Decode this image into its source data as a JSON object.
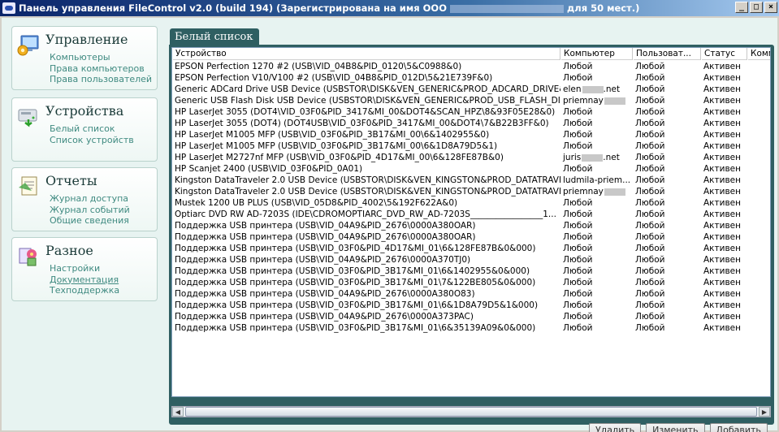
{
  "window": {
    "title_prefix": "Панель управления FileControl v2.0 (build 194) (Зарегистрирована на имя ООО",
    "title_suffix": "для 50 мест.)",
    "buttons": [
      "_",
      "□",
      "×"
    ]
  },
  "sidebar": {
    "sections": [
      {
        "title": "Управление",
        "icon": "monitor-gear-icon",
        "links": [
          "Компьютеры",
          "Права компьютеров",
          "Права пользователей"
        ]
      },
      {
        "title": "Устройства",
        "icon": "drive-icon",
        "links": [
          "Белый список",
          "Список устройств"
        ]
      },
      {
        "title": "Отчеты",
        "icon": "report-icon",
        "links": [
          "Журнал доступа",
          "Журнал событий",
          "Общие сведения"
        ]
      },
      {
        "title": "Разное",
        "icon": "misc-icon",
        "links": [
          "Настройки",
          "Документация",
          "Техподдержка"
        ]
      }
    ]
  },
  "main": {
    "tab": "Белый список",
    "columns": [
      "Устройство",
      "Компьютер",
      "Пользоват...",
      "Статус",
      "Комм"
    ],
    "rows": [
      [
        "EPSON Perfection 1270 #2 (USB\\VID_04B8&PID_0120\\5&C0988&0)",
        "Любой",
        "Любой",
        "Активен",
        ""
      ],
      [
        "EPSON Perfection V10/V100 #2 (USB\\VID_04B8&PID_012D\\5&21E739F&0)",
        "Любой",
        "Любой",
        "Активен",
        ""
      ],
      [
        "Generic ADCard Drive USB Device (USBSTOR\\DISK&VEN_GENERIC&PROD_ADCARD_DRIVE&RE...",
        "elen",
        "Любой",
        "Активен",
        ""
      ],
      [
        "Generic USB Flash Disk USB Device (USBSTOR\\DISK&VEN_GENERIC&PROD_USB_FLASH_DISK&...",
        "priemnay",
        "Любой",
        "Активен",
        ""
      ],
      [
        "HP LaserJet 3055 (DOT4\\VID_03F0&PID_3417&MI_00&DOT4&SCAN_HPZ\\8&93F05E28&0)",
        "Любой",
        "Любой",
        "Активен",
        ""
      ],
      [
        "HP LaserJet 3055 (DOT4) (DOT4USB\\VID_03F0&PID_3417&MI_00&DOT4\\7&B22B3FF&0)",
        "Любой",
        "Любой",
        "Активен",
        ""
      ],
      [
        "HP LaserJet M1005 MFP (USB\\VID_03F0&PID_3B17&MI_00\\6&1402955&0)",
        "Любой",
        "Любой",
        "Активен",
        ""
      ],
      [
        "HP LaserJet M1005 MFP (USB\\VID_03F0&PID_3B17&MI_00\\6&1D8A79D5&1)",
        "Любой",
        "Любой",
        "Активен",
        ""
      ],
      [
        "HP LaserJet M2727nf MFP (USB\\VID_03F0&PID_4D17&MI_00\\6&128FE87B&0)",
        "juris",
        "Любой",
        "Активен",
        ""
      ],
      [
        "HP Scanjet 2400 (USB\\VID_03F0&PID_0A01)",
        "Любой",
        "Любой",
        "Активен",
        ""
      ],
      [
        "Kingston DataTraveler 2.0 USB Device (USBSTOR\\DISK&VEN_KINGSTON&PROD_DATATRAVELE...",
        "ludmila-priem...",
        "Любой",
        "Активен",
        ""
      ],
      [
        "Kingston DataTraveler 2.0 USB Device (USBSTOR\\DISK&VEN_KINGSTON&PROD_DATATRAVELE...",
        "priemnay",
        "Любой",
        "Активен",
        ""
      ],
      [
        "Mustek 1200 UB PLUS (USB\\VID_05D8&PID_4002\\5&192F622A&0)",
        "Любой",
        "Любой",
        "Активен",
        ""
      ],
      [
        "Optiarc DVD RW AD-7203S (IDE\\CDROMOPTIARC_DVD_RW_AD-7203S_________________1...",
        "Любой",
        "Любой",
        "Активен",
        ""
      ],
      [
        "Поддержка USB принтера (USB\\VID_04A9&PID_2676\\0000A380OAR)",
        "Любой",
        "Любой",
        "Активен",
        ""
      ],
      [
        "Поддержка USB принтера (USB\\VID_04A9&PID_2676\\0000A380OAR)",
        "Любой",
        "Любой",
        "Активен",
        ""
      ],
      [
        "Поддержка USB принтера (USB\\VID_03F0&PID_4D17&MI_01\\6&128FE87B&0&000)",
        "Любой",
        "Любой",
        "Активен",
        ""
      ],
      [
        "Поддержка USB принтера (USB\\VID_04A9&PID_2676\\0000A370TJ0)",
        "Любой",
        "Любой",
        "Активен",
        ""
      ],
      [
        "Поддержка USB принтера (USB\\VID_03F0&PID_3B17&MI_01\\6&1402955&0&000)",
        "Любой",
        "Любой",
        "Активен",
        ""
      ],
      [
        "Поддержка USB принтера (USB\\VID_03F0&PID_3B17&MI_01\\7&122BE805&0&000)",
        "Любой",
        "Любой",
        "Активен",
        ""
      ],
      [
        "Поддержка USB принтера (USB\\VID_04A9&PID_2676\\0000A380O83)",
        "Любой",
        "Любой",
        "Активен",
        ""
      ],
      [
        "Поддержка USB принтера (USB\\VID_03F0&PID_3B17&MI_01\\6&1D8A79D5&1&000)",
        "Любой",
        "Любой",
        "Активен",
        ""
      ],
      [
        "Поддержка USB принтера (USB\\VID_04A9&PID_2676\\0000A373PAC)",
        "Любой",
        "Любой",
        "Активен",
        ""
      ],
      [
        "Поддержка USB принтера (USB\\VID_03F0&PID_3B17&MI_01\\6&35139A09&0&000)",
        "Любой",
        "Любой",
        "Активен",
        ""
      ]
    ],
    "masked_computer_suffix": {
      "2": ".net",
      "8": ".net"
    },
    "buttons": {
      "delete": "Удалить",
      "edit": "Изменить",
      "add": "Добавить"
    }
  }
}
